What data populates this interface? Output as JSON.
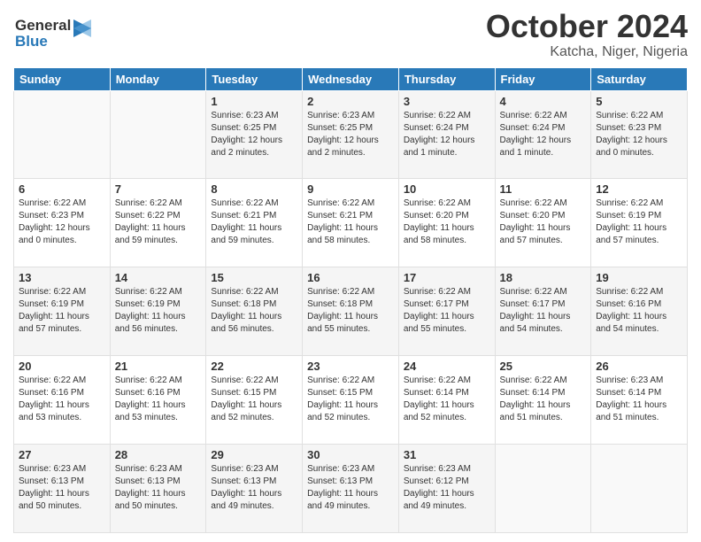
{
  "logo": {
    "line1": "General",
    "line2": "Blue"
  },
  "header": {
    "month": "October 2024",
    "location": "Katcha, Niger, Nigeria"
  },
  "weekdays": [
    "Sunday",
    "Monday",
    "Tuesday",
    "Wednesday",
    "Thursday",
    "Friday",
    "Saturday"
  ],
  "weeks": [
    [
      {
        "day": "",
        "info": ""
      },
      {
        "day": "",
        "info": ""
      },
      {
        "day": "1",
        "info": "Sunrise: 6:23 AM\nSunset: 6:25 PM\nDaylight: 12 hours and 2 minutes."
      },
      {
        "day": "2",
        "info": "Sunrise: 6:23 AM\nSunset: 6:25 PM\nDaylight: 12 hours and 2 minutes."
      },
      {
        "day": "3",
        "info": "Sunrise: 6:22 AM\nSunset: 6:24 PM\nDaylight: 12 hours and 1 minute."
      },
      {
        "day": "4",
        "info": "Sunrise: 6:22 AM\nSunset: 6:24 PM\nDaylight: 12 hours and 1 minute."
      },
      {
        "day": "5",
        "info": "Sunrise: 6:22 AM\nSunset: 6:23 PM\nDaylight: 12 hours and 0 minutes."
      }
    ],
    [
      {
        "day": "6",
        "info": "Sunrise: 6:22 AM\nSunset: 6:23 PM\nDaylight: 12 hours and 0 minutes."
      },
      {
        "day": "7",
        "info": "Sunrise: 6:22 AM\nSunset: 6:22 PM\nDaylight: 11 hours and 59 minutes."
      },
      {
        "day": "8",
        "info": "Sunrise: 6:22 AM\nSunset: 6:21 PM\nDaylight: 11 hours and 59 minutes."
      },
      {
        "day": "9",
        "info": "Sunrise: 6:22 AM\nSunset: 6:21 PM\nDaylight: 11 hours and 58 minutes."
      },
      {
        "day": "10",
        "info": "Sunrise: 6:22 AM\nSunset: 6:20 PM\nDaylight: 11 hours and 58 minutes."
      },
      {
        "day": "11",
        "info": "Sunrise: 6:22 AM\nSunset: 6:20 PM\nDaylight: 11 hours and 57 minutes."
      },
      {
        "day": "12",
        "info": "Sunrise: 6:22 AM\nSunset: 6:19 PM\nDaylight: 11 hours and 57 minutes."
      }
    ],
    [
      {
        "day": "13",
        "info": "Sunrise: 6:22 AM\nSunset: 6:19 PM\nDaylight: 11 hours and 57 minutes."
      },
      {
        "day": "14",
        "info": "Sunrise: 6:22 AM\nSunset: 6:19 PM\nDaylight: 11 hours and 56 minutes."
      },
      {
        "day": "15",
        "info": "Sunrise: 6:22 AM\nSunset: 6:18 PM\nDaylight: 11 hours and 56 minutes."
      },
      {
        "day": "16",
        "info": "Sunrise: 6:22 AM\nSunset: 6:18 PM\nDaylight: 11 hours and 55 minutes."
      },
      {
        "day": "17",
        "info": "Sunrise: 6:22 AM\nSunset: 6:17 PM\nDaylight: 11 hours and 55 minutes."
      },
      {
        "day": "18",
        "info": "Sunrise: 6:22 AM\nSunset: 6:17 PM\nDaylight: 11 hours and 54 minutes."
      },
      {
        "day": "19",
        "info": "Sunrise: 6:22 AM\nSunset: 6:16 PM\nDaylight: 11 hours and 54 minutes."
      }
    ],
    [
      {
        "day": "20",
        "info": "Sunrise: 6:22 AM\nSunset: 6:16 PM\nDaylight: 11 hours and 53 minutes."
      },
      {
        "day": "21",
        "info": "Sunrise: 6:22 AM\nSunset: 6:16 PM\nDaylight: 11 hours and 53 minutes."
      },
      {
        "day": "22",
        "info": "Sunrise: 6:22 AM\nSunset: 6:15 PM\nDaylight: 11 hours and 52 minutes."
      },
      {
        "day": "23",
        "info": "Sunrise: 6:22 AM\nSunset: 6:15 PM\nDaylight: 11 hours and 52 minutes."
      },
      {
        "day": "24",
        "info": "Sunrise: 6:22 AM\nSunset: 6:14 PM\nDaylight: 11 hours and 52 minutes."
      },
      {
        "day": "25",
        "info": "Sunrise: 6:22 AM\nSunset: 6:14 PM\nDaylight: 11 hours and 51 minutes."
      },
      {
        "day": "26",
        "info": "Sunrise: 6:23 AM\nSunset: 6:14 PM\nDaylight: 11 hours and 51 minutes."
      }
    ],
    [
      {
        "day": "27",
        "info": "Sunrise: 6:23 AM\nSunset: 6:13 PM\nDaylight: 11 hours and 50 minutes."
      },
      {
        "day": "28",
        "info": "Sunrise: 6:23 AM\nSunset: 6:13 PM\nDaylight: 11 hours and 50 minutes."
      },
      {
        "day": "29",
        "info": "Sunrise: 6:23 AM\nSunset: 6:13 PM\nDaylight: 11 hours and 49 minutes."
      },
      {
        "day": "30",
        "info": "Sunrise: 6:23 AM\nSunset: 6:13 PM\nDaylight: 11 hours and 49 minutes."
      },
      {
        "day": "31",
        "info": "Sunrise: 6:23 AM\nSunset: 6:12 PM\nDaylight: 11 hours and 49 minutes."
      },
      {
        "day": "",
        "info": ""
      },
      {
        "day": "",
        "info": ""
      }
    ]
  ]
}
